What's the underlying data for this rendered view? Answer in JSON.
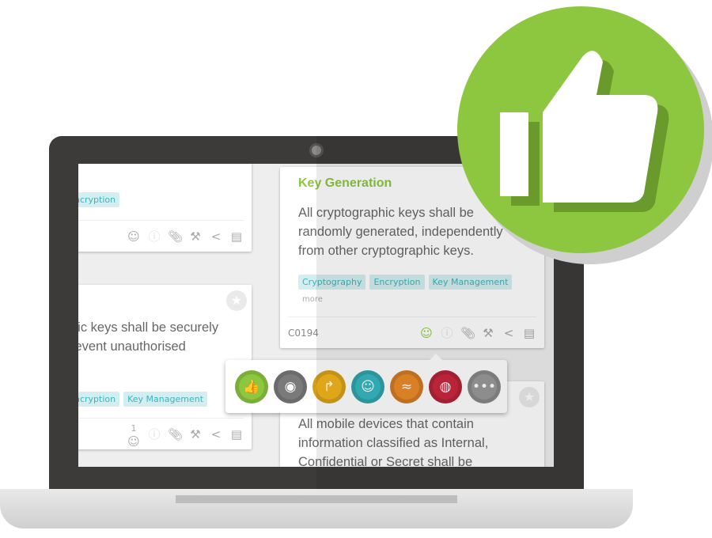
{
  "colors": {
    "accent": "#8dc63f",
    "tag_bg": "#d3eef0",
    "tag_text": "#3fb3bd",
    "bezel": "#3c3b39"
  },
  "cards": [
    {
      "tags": [
        "ncryption"
      ],
      "icons": [
        "smiley-icon",
        "info-icon",
        "paperclip-icon",
        "gavel-icon",
        "share-icon",
        "comment-icon"
      ]
    },
    {
      "body": [
        "hic keys shall be securely",
        "revent unauthorised"
      ],
      "tags": [
        "ncryption",
        "Key Management"
      ],
      "reaction_count": "1"
    },
    {
      "title": "Key Generation",
      "body": [
        "All cryptographic keys shall be",
        "randomly generated, independently",
        "from other cryptographic keys."
      ],
      "tags": [
        "Cryptography",
        "Encryption",
        "Key Management"
      ],
      "more": "more",
      "id": "C0194"
    },
    {
      "body": [
        "All mobile devices that contain",
        "information classified as Internal,",
        "Confidential or Secret shall be"
      ]
    }
  ],
  "reactions": [
    {
      "name": "like",
      "color": "#8dc63f",
      "glyph": "👍"
    },
    {
      "name": "watch",
      "color": "#7a7a7a",
      "glyph": "◉"
    },
    {
      "name": "forward",
      "color": "#f2b51c",
      "glyph": "↱"
    },
    {
      "name": "speak",
      "color": "#37b8c0",
      "glyph": "☺"
    },
    {
      "name": "confused",
      "color": "#ec8a2a",
      "glyph": "≈"
    },
    {
      "name": "meat",
      "color": "#c9283e",
      "glyph": "◍"
    },
    {
      "name": "more",
      "color": "#9a9a9a",
      "glyph": "•••"
    }
  ]
}
